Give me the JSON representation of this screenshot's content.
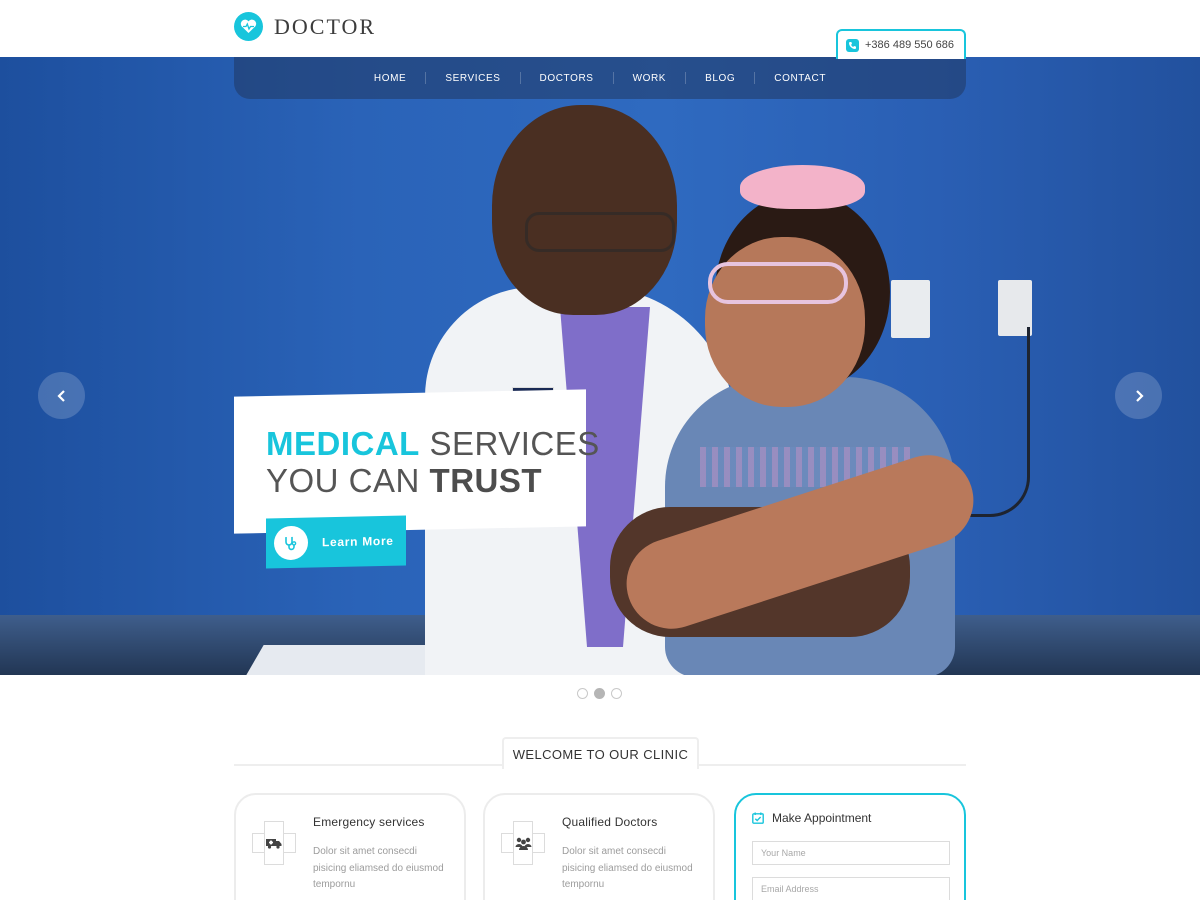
{
  "brand": {
    "name": "DOCTOR",
    "logo_icon": "heart-pulse-icon"
  },
  "header": {
    "phone": "+386 489 550 686",
    "phone_icon": "phone-icon"
  },
  "nav": {
    "items": [
      "HOME",
      "SERVICES",
      "DOCTORS",
      "WORK",
      "BLOG",
      "CONTACT"
    ]
  },
  "hero": {
    "line1_accent": "MEDICAL",
    "line1_rest": " SERVICES",
    "line2_rest": "YOU CAN ",
    "line2_strong": "TRUST",
    "cta_label": "Learn More",
    "cta_icon": "stethoscope-icon",
    "prev_icon": "chevron-left-icon",
    "next_icon": "chevron-right-icon",
    "slides_total": 3,
    "slide_active": 2
  },
  "welcome": {
    "title": "WELCOME TO OUR CLINIC"
  },
  "cards": [
    {
      "title": "Emergency services",
      "desc": "Dolor sit amet consecdi pisicing eliamsed do eiusmod tempornu",
      "icon": "ambulance-icon"
    },
    {
      "title": "Qualified Doctors",
      "desc": "Dolor sit amet consecdi pisicing eliamsed do eiusmod tempornu",
      "icon": "group-icon"
    }
  ],
  "appointment": {
    "title": "Make Appointment",
    "icon": "calendar-check-icon",
    "name_placeholder": "Your Name",
    "email_placeholder": "Email Address"
  },
  "colors": {
    "accent": "#18c5dc",
    "hero_blue": "#2a63b8",
    "text": "#333333"
  }
}
